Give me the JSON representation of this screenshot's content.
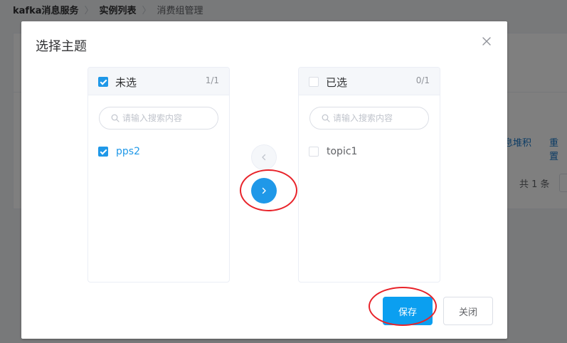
{
  "breadcrumb": {
    "items": [
      "kafka消息服务",
      "实例列表",
      "消费组管理"
    ],
    "separator": "〉"
  },
  "background": {
    "links": [
      "息堆积",
      "重置"
    ],
    "total": "共 1 条"
  },
  "dialog": {
    "title": "选择主题",
    "left_panel": {
      "title": "未选",
      "count": "1/1",
      "search_placeholder": "请输入搜索内容",
      "items": [
        {
          "label": "pps2",
          "checked": true
        }
      ]
    },
    "right_panel": {
      "title": "已选",
      "count": "0/1",
      "search_placeholder": "请输入搜索内容",
      "items": [
        {
          "label": "topic1",
          "checked": false
        }
      ]
    },
    "buttons": {
      "save": "保存",
      "close": "关闭"
    }
  },
  "colors": {
    "primary": "#1f98e8",
    "annotation": "#e8232a"
  }
}
